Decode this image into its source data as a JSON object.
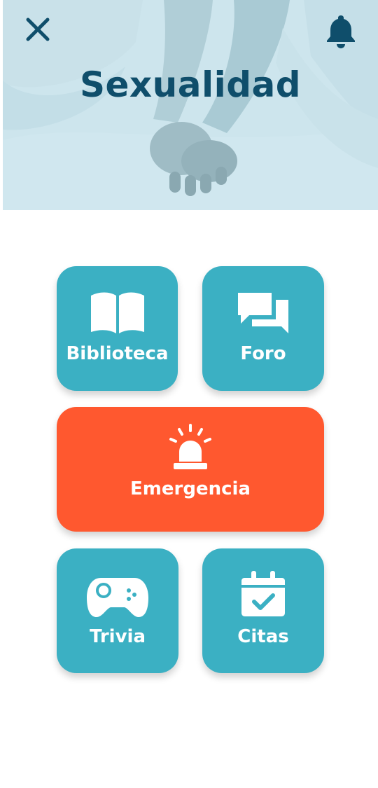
{
  "header": {
    "title": "Sexualidad",
    "close_icon": "close-icon",
    "notification_icon": "bell-icon"
  },
  "menu": {
    "biblioteca": {
      "label": "Biblioteca",
      "icon": "book-open-icon"
    },
    "foro": {
      "label": "Foro",
      "icon": "chat-bubbles-icon"
    },
    "emergencia": {
      "label": "Emergencia",
      "icon": "alarm-siren-icon"
    },
    "trivia": {
      "label": "Trivia",
      "icon": "gamepad-icon"
    },
    "citas": {
      "label": "Citas",
      "icon": "calendar-check-icon"
    }
  },
  "colors": {
    "title": "#0f4e6b",
    "icon_dark": "#0f4e6b",
    "tile_teal": "#3bb0c3",
    "tile_emergency": "#ff582f",
    "tile_text": "#ffffff"
  }
}
